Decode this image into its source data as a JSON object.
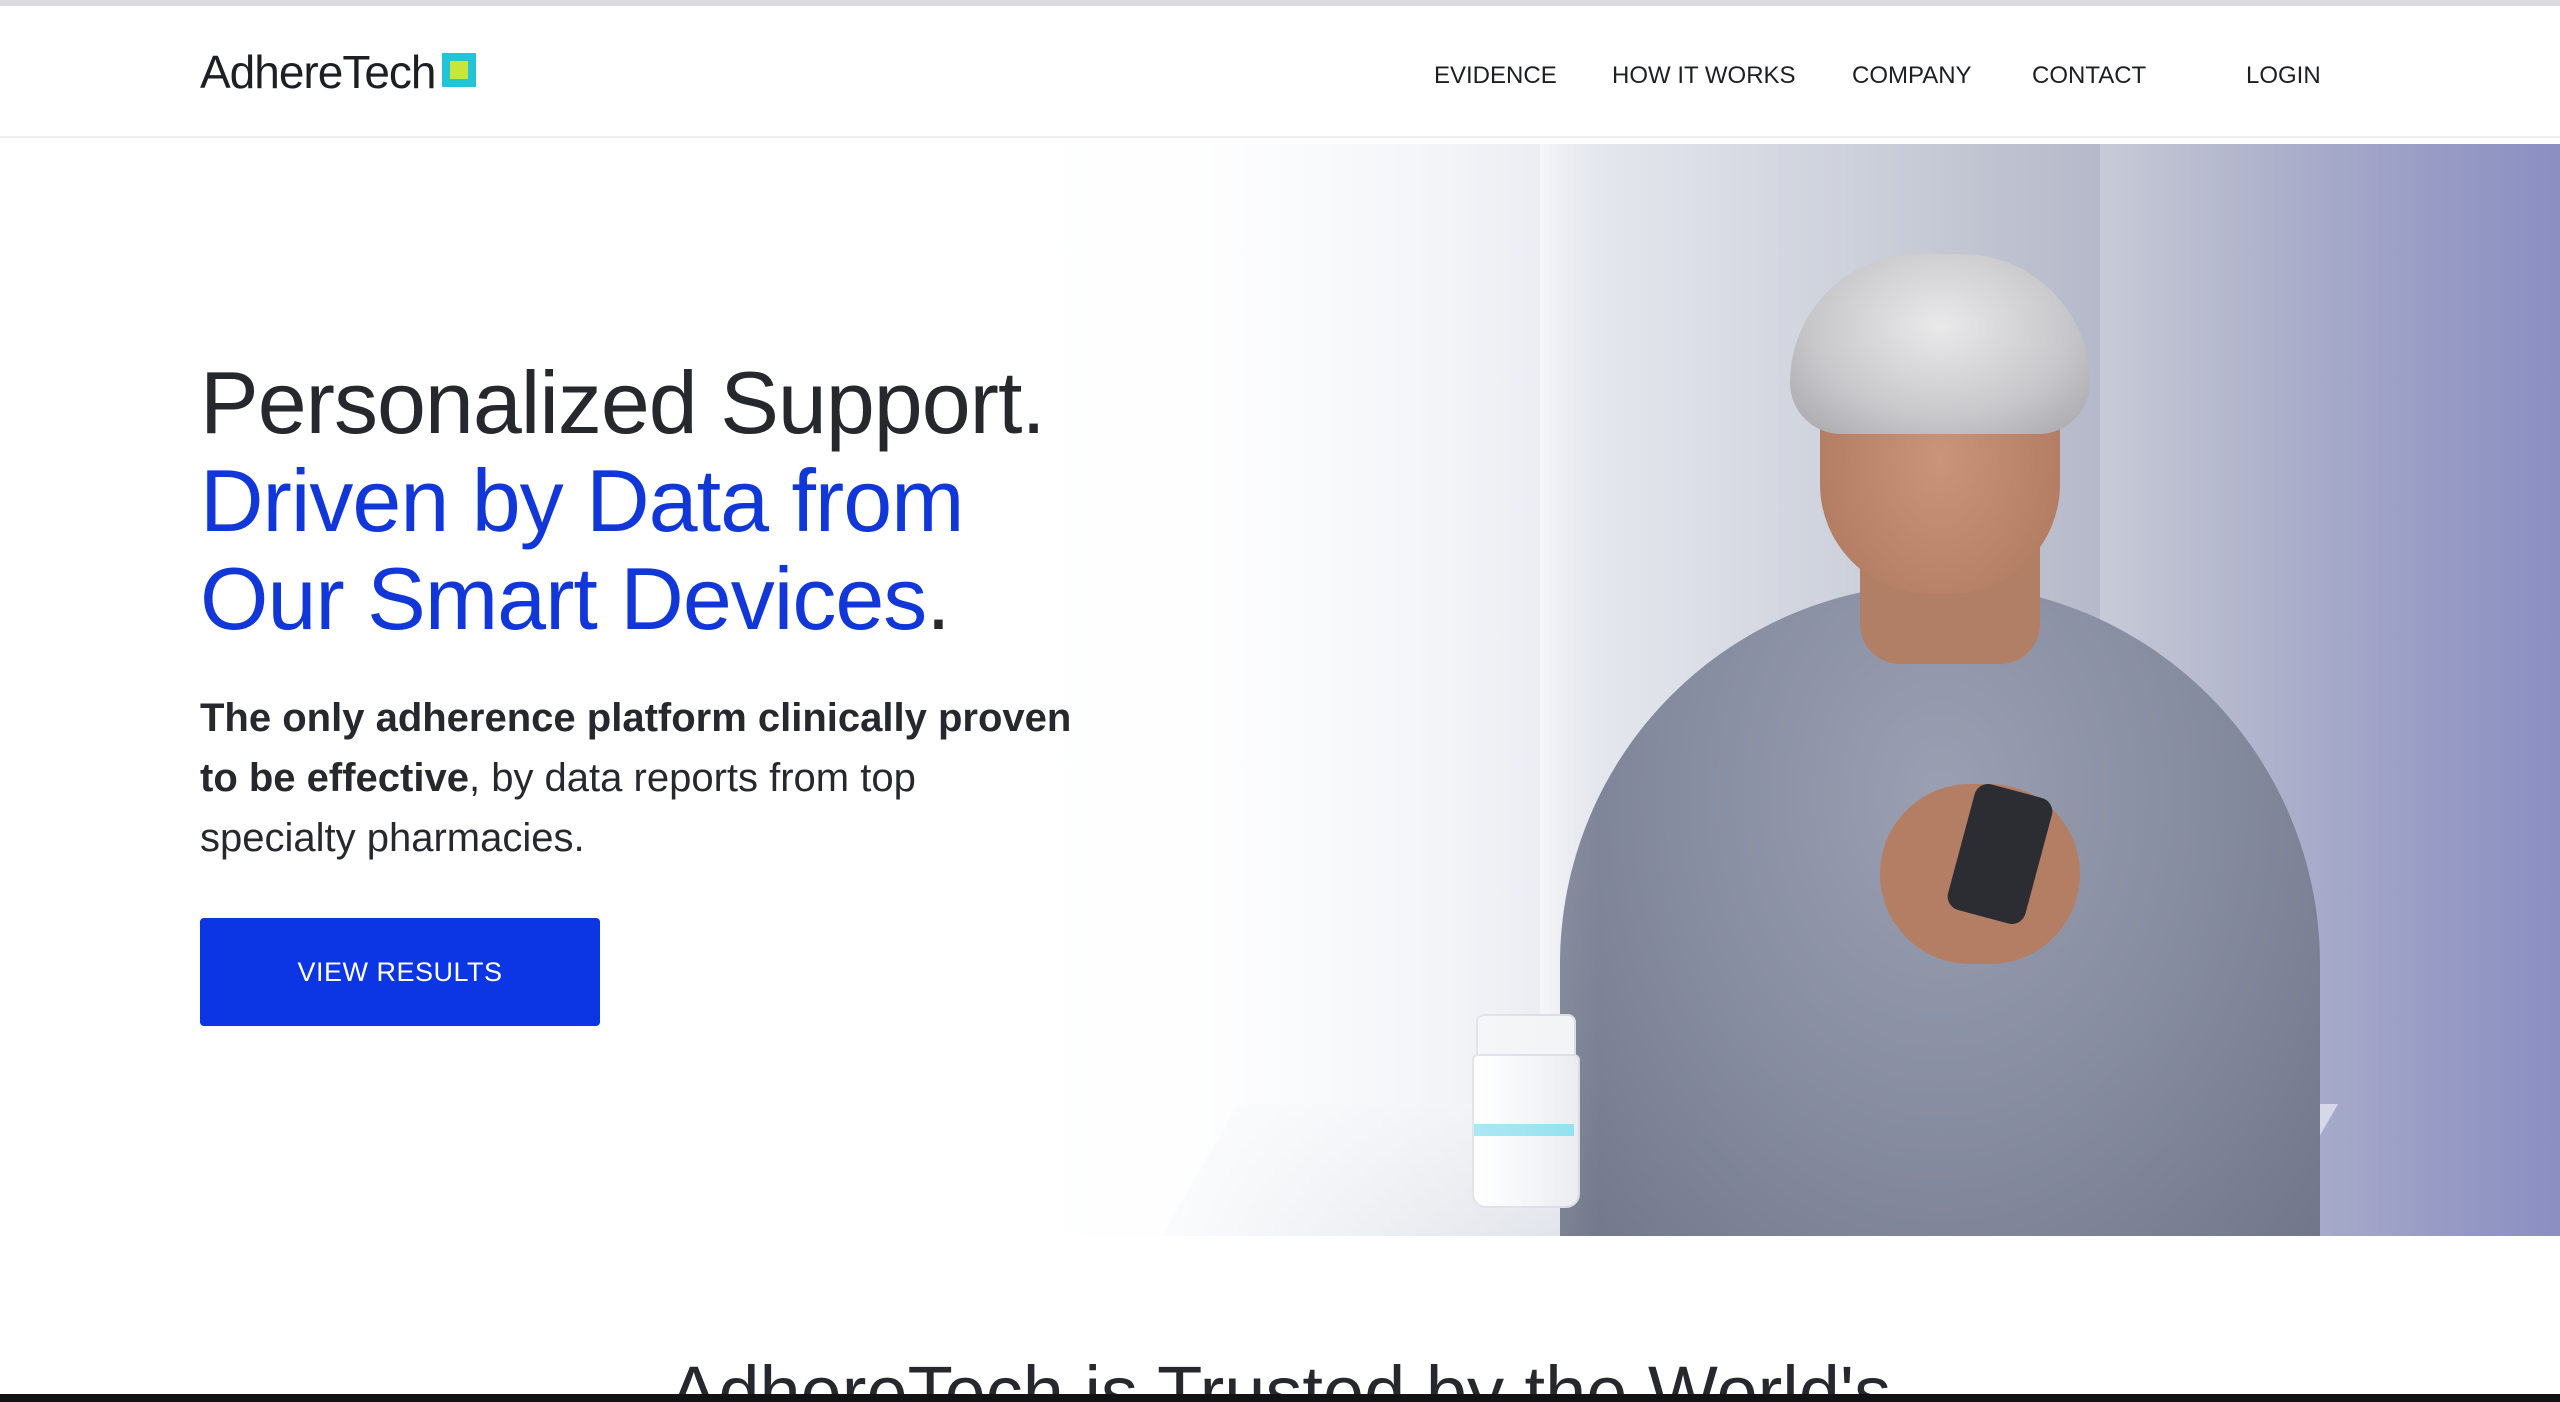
{
  "brand": {
    "name": "AdhereTech",
    "colors": {
      "primary_blue": "#0c36e3",
      "headline_blue": "#1237d8",
      "logo_cyan": "#21c4d9",
      "logo_lime": "#c8e53a",
      "text_dark": "#26282e"
    }
  },
  "nav": {
    "items": [
      {
        "label": "EVIDENCE"
      },
      {
        "label": "HOW IT WORKS"
      },
      {
        "label": "COMPANY"
      },
      {
        "label": "CONTACT"
      }
    ],
    "login_label": "LOGIN"
  },
  "hero": {
    "title_line1": "Personalized Support.",
    "title_line2": "Driven by Data from",
    "title_line3": "Our Smart Devices",
    "title_period": ".",
    "sub_bold": "The only adherence platform clinically proven to be effective",
    "sub_rest": ", by data reports from top specialty pharmacies.",
    "cta_label": "VIEW RESULTS",
    "image_icon": "hero-photo-woman-with-phone"
  },
  "section": {
    "heading": "AdhereTech is Trusted by the World's"
  }
}
